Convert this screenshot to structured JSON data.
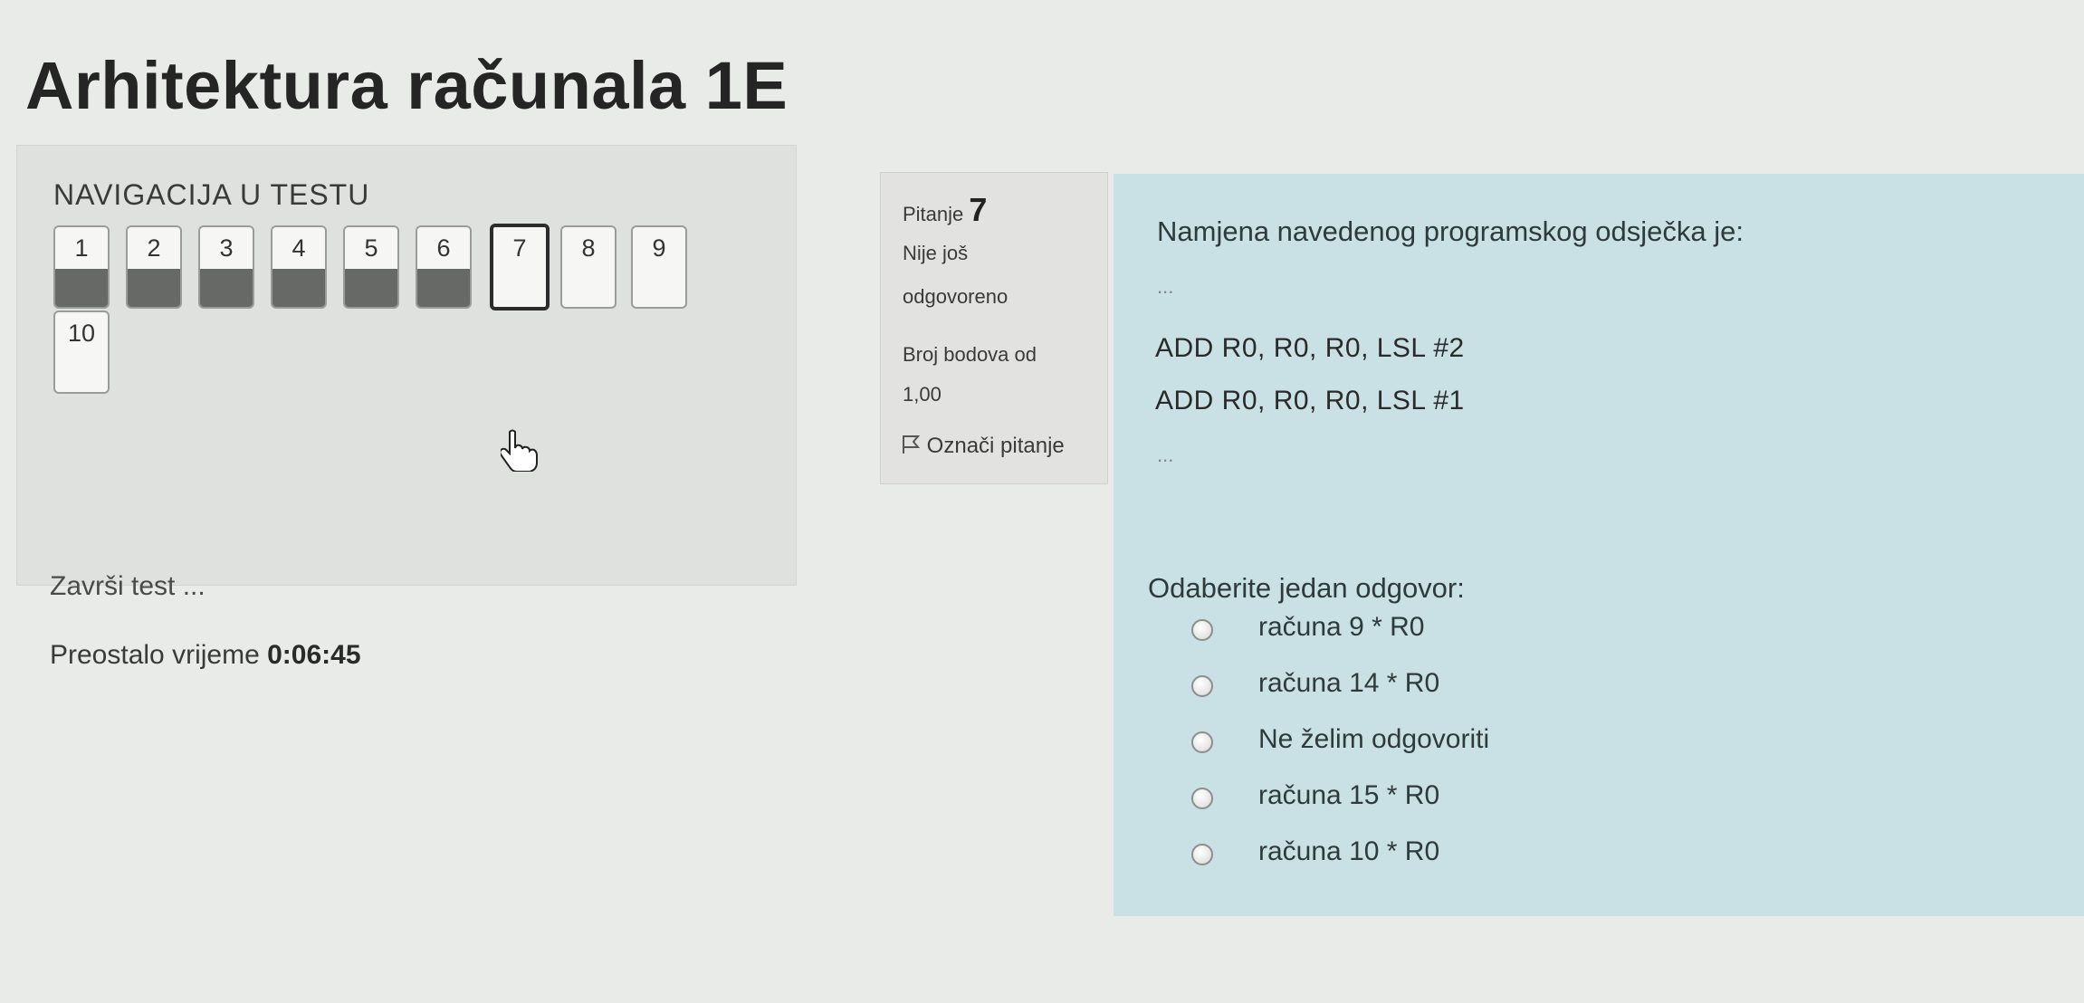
{
  "page": {
    "title": "Arhitektura računala 1E"
  },
  "navigation": {
    "title": "NAVIGACIJA U TESTU",
    "questions": [
      {
        "label": "1",
        "state": "answered"
      },
      {
        "label": "2",
        "state": "answered"
      },
      {
        "label": "3",
        "state": "answered"
      },
      {
        "label": "4",
        "state": "answered"
      },
      {
        "label": "5",
        "state": "answered"
      },
      {
        "label": "6",
        "state": "answered"
      },
      {
        "label": "7",
        "state": "current"
      },
      {
        "label": "8",
        "state": "unanswered"
      },
      {
        "label": "9",
        "state": "unanswered"
      },
      {
        "label": "10",
        "state": "unanswered"
      }
    ],
    "finish_label": "Završi test ...",
    "timer_label": "Preostalo vrijeme",
    "timer_value": "0:06:45"
  },
  "question_info": {
    "label": "Pitanje",
    "number": "7",
    "status_line1": "Nije još",
    "status_line2": "odgovoreno",
    "points_label": "Broj bodova od",
    "points_value": "1,00",
    "flag_label": "Označi pitanje"
  },
  "question": {
    "prompt": "Namjena navedenog programskog odsječka je:",
    "ellipsis_top": "...",
    "code_line1": "ADD R0, R0, R0, LSL #2",
    "code_line2": "ADD R0, R0, R0, LSL #1",
    "ellipsis_bottom": "...",
    "select_prompt": "Odaberite jedan odgovor:",
    "options": [
      "računa 9 * R0",
      "računa 14 * R0",
      "Ne želim odgovoriti",
      "računa 15 * R0",
      "računa 10 * R0"
    ]
  },
  "colors": {
    "content_background": "#c9e1e4",
    "answered_fill": "#676967"
  }
}
